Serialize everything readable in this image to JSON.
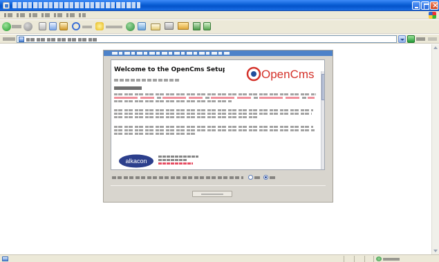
{
  "window": {
    "title": "",
    "buttons": {
      "minimize": "minimize",
      "maximize": "maximize",
      "close": "close"
    }
  },
  "toolbar": {
    "back_label": "",
    "search_label": "",
    "favorites_label": ""
  },
  "address_bar": {
    "label": "",
    "url": "",
    "go_label": "",
    "links_label": ""
  },
  "setup": {
    "header": "",
    "welcome_heading": "Welcome to the OpenCms Setup",
    "logo_text": "OpenCms",
    "alkacon_logo_text": "alkacon",
    "subtitle": "",
    "section_heading": "",
    "accept_prompt": "",
    "radio_yes": "",
    "radio_no": "",
    "continue_button": "",
    "accept_selected": "no"
  },
  "status_bar": {
    "text": "",
    "zone": ""
  },
  "colors": {
    "titlebar": "#0a5fd6",
    "dialog_header": "#4d82c9",
    "opencms_red": "#d4322a",
    "opencms_blue": "#1f4e9c",
    "alkacon_blue": "#2c3f8c",
    "link_red": "#e0203a",
    "panel_gray": "#d8d5ce"
  },
  "icons": {
    "back": "back-arrow-icon",
    "forward": "forward-arrow-icon",
    "stop": "stop-icon",
    "refresh": "refresh-icon",
    "home": "home-icon",
    "search": "search-icon",
    "favorites": "favorites-star-icon",
    "media": "media-icon",
    "history": "history-icon",
    "mail": "mail-icon",
    "print": "print-icon",
    "edit": "edit-icon",
    "go": "go-arrow-icon"
  }
}
